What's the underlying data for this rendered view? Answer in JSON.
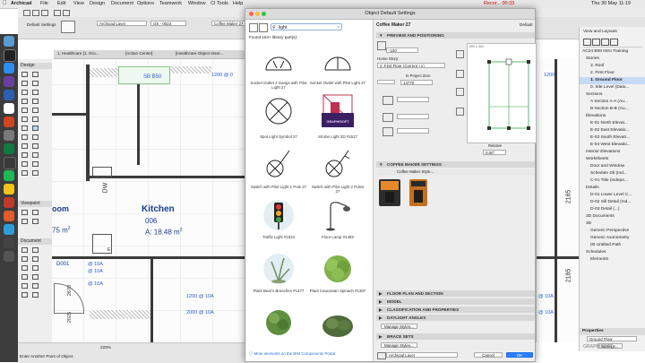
{
  "menubar": {
    "app": "Archicad",
    "items": [
      "File",
      "Edit",
      "View",
      "Design",
      "Document",
      "Options",
      "Teamwork",
      "Window",
      "CI Tools",
      "Help"
    ],
    "clock": "Thu 30 May  11:19",
    "recording": "Recor... 00:33"
  },
  "app": {
    "default_settings_label": "Default Settings",
    "layer_value": "Archicad Layer",
    "id_value": "OS - 0023",
    "element_value": "Coffee Maker 27",
    "tabs": [
      "1. Healthcare [1. Gro...",
      "[Action Center]",
      "[Healthcare Object Inser..."
    ]
  },
  "toolbox": {
    "sections": [
      "Design",
      "Viewpoint",
      "Document"
    ]
  },
  "plan": {
    "room_name": "Kitchen",
    "room_number": "006",
    "room_area_prefix": "A: 18.48 m",
    "room_area_sup": "2",
    "room_partial": "oom",
    "area_partial": "75 m",
    "area_partial_sup": "2",
    "label_sb": "SB B50",
    "label_dw": "DW",
    "label_e": "E",
    "label_d001": "D001",
    "dims": [
      "1200 @ 0",
      "2670",
      "2025",
      "@ 10A",
      "@ 10A",
      "@ 10A",
      "1200 @ 10A",
      "2000 @ 10A"
    ],
    "zoom": "220%",
    "status_hint": "Enter Another Point of Object"
  },
  "dialog": {
    "title": "Object Default Settings",
    "search_value": "light",
    "found_text": "Found 164+ library part(s):",
    "objects": [
      {
        "label": "Socket Outlet 2 Gangs with Pilot Light 27"
      },
      {
        "label": "Socket Outlet with Pilot Light 27"
      },
      {
        "label": "Spot Light Symbol 27"
      },
      {
        "label": "Strobe Light 2D #1617"
      },
      {
        "label": "Switch with Pilot Light 1 Pole 27"
      },
      {
        "label": "Switch with Pilot Light 2 Poles 27"
      },
      {
        "label": "Traffic Light #1534"
      },
      {
        "label": "Floor Lamp #1459"
      },
      {
        "label": "Plant Bear's Breeches #1377"
      },
      {
        "label": "Plant Caucasian Spinach #1387"
      },
      {
        "label": "",
        "kind": "plant-small"
      },
      {
        "label": "",
        "kind": "shrub"
      }
    ],
    "strobe_brand": "GRAPHISOFT",
    "portal_link": "More elements on the BIM Components Portal",
    "selected_name": "Coffee Maker 27",
    "default_label": "Default",
    "sections": {
      "preview": "PREVIEW AND POSITIONING",
      "settings": "COFFEE MAKER SETTINGS",
      "floor": "FLOOR PLAN AND SECTION",
      "model": "MODEL",
      "classification": "CLASSIFICATION AND PROPERTIES",
      "daylight": "DAYLIGHT ANGLES",
      "brace": "BRACE SETS"
    },
    "height_value": "-100",
    "home_story_label": "Home Story:",
    "home_story_value": "2. First Floor (Current +1)",
    "project_zero": "to Project Zero",
    "elevation_value": "14770",
    "size_a": "500 x 300",
    "rotation_label": "Relative",
    "rotation_value": "0.00°",
    "style_label": "Coffee Maker Style...",
    "manage_styles_1": "Manage Styles...",
    "manage_styles_2": "Manage Styles...",
    "layer_value": "Archicad Layer",
    "cancel": "Cancel",
    "ok": "OK"
  },
  "navigator": {
    "header": "View and Layouts",
    "items": [
      "AC24 BIM Intro Training",
      "Stories",
      "3. Roof",
      "2. First Floor",
      "1. Ground Floor",
      "0. Site Level (Datu...",
      "Sections",
      "A Section A-A (Au...",
      "B Section B-B (Au...",
      "Elevations",
      "E-01 North Elevat...",
      "E-02 East Elevatio...",
      "E-03 South Elevati...",
      "E-04 West Elevatio...",
      "Interior Elevations",
      "Worksheets",
      "Door and Window",
      "Schedule Dtl (Ind...",
      "C-01 Title (indepe...",
      "Details",
      "D-01 Lower Level C...",
      "D-02 Sill Detail (Ind...",
      "D-03 Detail (...)",
      "3D Documents",
      "3D",
      "Generic Perspective",
      "Generic Axonometry",
      "00 Untitled Path",
      "Schedules",
      "Elements"
    ],
    "properties_label": "Properties",
    "prop_value": "Ground Floor",
    "settings_btn": "Settings...",
    "watermark": "GRAPHISOFT"
  },
  "right_dims": [
    "1200",
    "2185",
    "2185",
    "@ 10A",
    "@ 10A"
  ],
  "colors": {
    "accent": "#2a6fd6",
    "dim_blue": "#2a5bd7",
    "room_blue": "#1a3b8f",
    "ok_button": "#2d7ff9"
  }
}
